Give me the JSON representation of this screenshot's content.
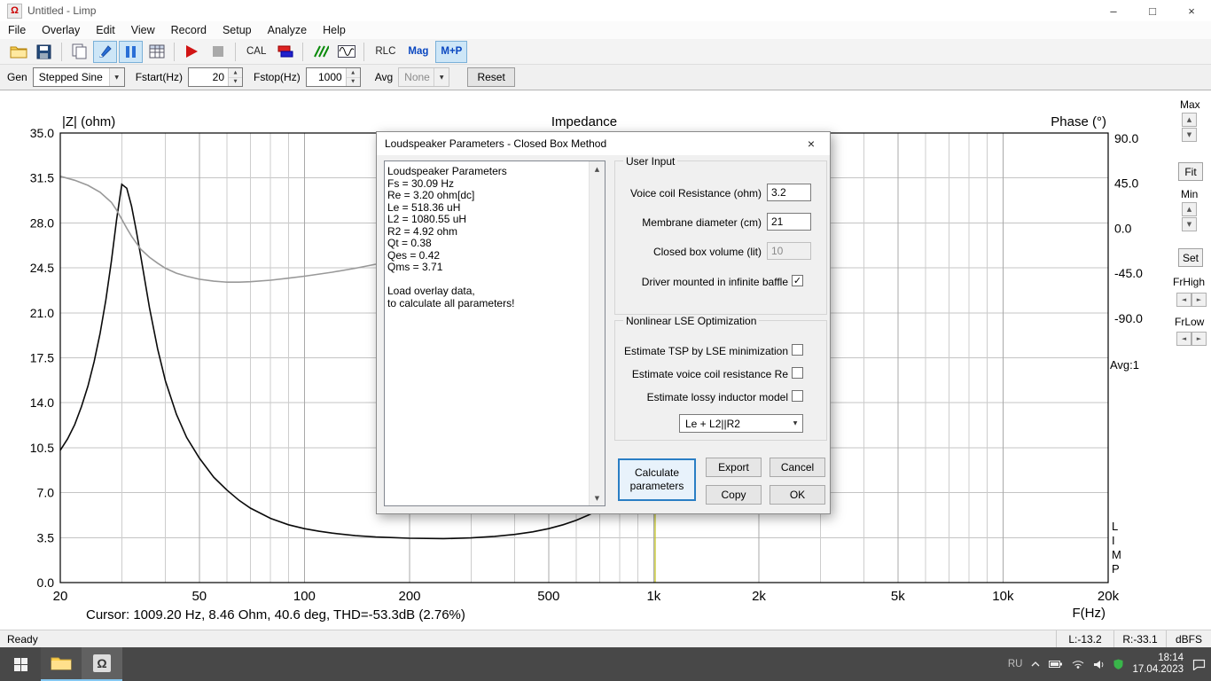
{
  "titlebar": {
    "title": "Untitled - Limp",
    "app_glyph": "Ω",
    "minimize_glyph": "–",
    "maximize_glyph": "□",
    "close_glyph": "×"
  },
  "menubar": {
    "items": [
      "File",
      "Overlay",
      "Edit",
      "View",
      "Record",
      "Setup",
      "Analyze",
      "Help"
    ]
  },
  "toolbar": {
    "cal": "CAL",
    "rlc": "RLC",
    "mag": "Mag",
    "mp": "M+P"
  },
  "controlbar": {
    "gen_label": "Gen",
    "gen_value": "Stepped Sine",
    "fstart_label": "Fstart(Hz)",
    "fstart_value": "20",
    "fstop_label": "Fstop(Hz)",
    "fstop_value": "1000",
    "avg_label": "Avg",
    "avg_value": "None",
    "reset": "Reset"
  },
  "chart_data": {
    "type": "line",
    "title": "Impedance",
    "left_axis": {
      "label": "|Z| (ohm)",
      "range": [
        0,
        35
      ],
      "ticks": [
        35,
        31.5,
        28,
        24.5,
        21,
        17.5,
        14,
        10.5,
        7,
        3.5,
        0
      ]
    },
    "right_axis": {
      "label": "Phase (°)",
      "ticks": [
        90,
        45,
        0,
        -45,
        -90
      ]
    },
    "x_axis": {
      "label": "F(Hz)",
      "scale": "log",
      "range": [
        20,
        20000
      ],
      "tick_values": [
        20,
        50,
        100,
        200,
        500,
        1000,
        2000,
        5000,
        10000,
        20000
      ],
      "tick_labels": [
        "20",
        "50",
        "100",
        "200",
        "500",
        "1k",
        "2k",
        "5k",
        "10k",
        "20k"
      ],
      "minor_gridlines": [
        30,
        40,
        60,
        70,
        80,
        90,
        300,
        400,
        600,
        700,
        800,
        900,
        3000,
        4000,
        6000,
        7000,
        8000,
        9000
      ]
    },
    "series": [
      {
        "name": "Impedance magnitude",
        "axis": "left",
        "unit": "ohm",
        "color": "#0a0a0a",
        "points": [
          [
            20,
            10.3
          ],
          [
            21,
            11.2
          ],
          [
            22,
            12.3
          ],
          [
            23,
            13.7
          ],
          [
            24,
            15.3
          ],
          [
            25,
            17.2
          ],
          [
            26,
            19.4
          ],
          [
            27,
            22.0
          ],
          [
            28,
            25.0
          ],
          [
            29,
            28.3
          ],
          [
            30,
            31.0
          ],
          [
            31,
            30.7
          ],
          [
            32,
            29.3
          ],
          [
            33,
            27.4
          ],
          [
            34,
            25.4
          ],
          [
            36,
            21.4
          ],
          [
            38,
            18.2
          ],
          [
            40,
            15.7
          ],
          [
            43,
            13.1
          ],
          [
            46,
            11.3
          ],
          [
            50,
            9.7
          ],
          [
            55,
            8.2
          ],
          [
            60,
            7.2
          ],
          [
            65,
            6.4
          ],
          [
            70,
            5.8
          ],
          [
            80,
            5.0
          ],
          [
            90,
            4.5
          ],
          [
            100,
            4.2
          ],
          [
            110,
            4.0
          ],
          [
            120,
            3.85
          ],
          [
            140,
            3.65
          ],
          [
            160,
            3.55
          ],
          [
            180,
            3.5
          ],
          [
            200,
            3.45
          ],
          [
            250,
            3.42
          ],
          [
            300,
            3.48
          ],
          [
            350,
            3.6
          ],
          [
            400,
            3.75
          ],
          [
            450,
            3.95
          ],
          [
            500,
            4.2
          ],
          [
            550,
            4.5
          ],
          [
            600,
            4.85
          ],
          [
            650,
            5.25
          ],
          [
            700,
            5.7
          ],
          [
            750,
            6.2
          ],
          [
            800,
            6.75
          ],
          [
            850,
            7.25
          ],
          [
            900,
            7.7
          ],
          [
            950,
            8.1
          ],
          [
            1000,
            8.46
          ]
        ]
      },
      {
        "name": "Phase",
        "axis": "right",
        "unit": "deg",
        "color": "#999999",
        "points": [
          [
            20,
            52
          ],
          [
            22,
            48
          ],
          [
            24,
            43
          ],
          [
            26,
            36
          ],
          [
            28,
            26
          ],
          [
            29,
            18
          ],
          [
            30,
            9
          ],
          [
            31,
            0
          ],
          [
            32,
            -8
          ],
          [
            34,
            -21
          ],
          [
            36,
            -29
          ],
          [
            38,
            -35
          ],
          [
            40,
            -40
          ],
          [
            43,
            -45
          ],
          [
            46,
            -48
          ],
          [
            50,
            -51
          ],
          [
            55,
            -53
          ],
          [
            60,
            -54
          ],
          [
            65,
            -54
          ],
          [
            70,
            -53.5
          ],
          [
            80,
            -52
          ],
          [
            90,
            -50
          ],
          [
            100,
            -48
          ],
          [
            120,
            -44
          ],
          [
            140,
            -40
          ],
          [
            160,
            -36
          ],
          [
            180,
            -32
          ],
          [
            200,
            -29
          ],
          [
            250,
            -22
          ],
          [
            300,
            -16
          ],
          [
            350,
            -11
          ],
          [
            400,
            -6
          ],
          [
            450,
            -2
          ],
          [
            500,
            2
          ],
          [
            550,
            6
          ],
          [
            600,
            10
          ],
          [
            650,
            14
          ],
          [
            700,
            18
          ],
          [
            750,
            22
          ],
          [
            800,
            26
          ],
          [
            850,
            30
          ],
          [
            900,
            34
          ],
          [
            950,
            37.5
          ],
          [
            1000,
            40.6
          ]
        ]
      }
    ],
    "cursor": {
      "freq_hz": 1009.2,
      "color": "#c6c62e",
      "text": "Cursor: 1009.20 Hz, 8.46 Ohm, 40.6 deg, THD=-53.3dB (2.76%)"
    },
    "grid": true,
    "legend": false
  },
  "side_panel": {
    "max": "Max",
    "fit": "Fit",
    "min": "Min",
    "set": "Set",
    "frhigh": "FrHigh",
    "frlow": "FrLow",
    "avg": "Avg:1",
    "limp": [
      "L",
      "I",
      "M",
      "P"
    ]
  },
  "dialog": {
    "title": "Loudspeaker Parameters - Closed Box Method",
    "results": [
      "Loudspeaker Parameters",
      "Fs = 30.09 Hz",
      "Re = 3.20 ohm[dc]",
      "Le = 518.36 uH",
      "L2 = 1080.55 uH",
      "R2 = 4.92 ohm",
      "Qt = 0.38",
      "Qes = 0.42",
      "Qms = 3.71",
      "",
      "Load overlay data,",
      "to calculate all parameters!"
    ],
    "user_input": {
      "title": "User Input",
      "voice_coil_label": "Voice coil Resistance (ohm)",
      "voice_coil_value": "3.2",
      "membrane_label": "Membrane diameter (cm)",
      "membrane_value": "21",
      "box_volume_label": "Closed box volume (lit)",
      "box_volume_value": "10",
      "baffle_label": "Driver mounted in infinite baffle",
      "baffle_checked": true
    },
    "lse": {
      "title": "Nonlinear LSE Optimization",
      "opt1": "Estimate TSP by LSE minimization",
      "opt2": "Estimate voice coil resistance Re",
      "opt3": "Estimate lossy inductor model",
      "inductor_model": "Le + L2||R2"
    },
    "buttons": {
      "calculate": "Calculate parameters",
      "export": "Export",
      "cancel": "Cancel",
      "copy": "Copy",
      "ok": "OK"
    }
  },
  "statusbar": {
    "ready": "Ready",
    "l": "L:-13.2",
    "r": "R:-33.1",
    "dbfs": "dBFS"
  },
  "taskbar": {
    "lang": "RU",
    "time": "18:14",
    "date": "17.04.2023"
  },
  "icons": {
    "check": "✓",
    "arrow_up": "▲",
    "arrow_down": "▼",
    "arrow_left": "◄",
    "arrow_right": "►"
  }
}
